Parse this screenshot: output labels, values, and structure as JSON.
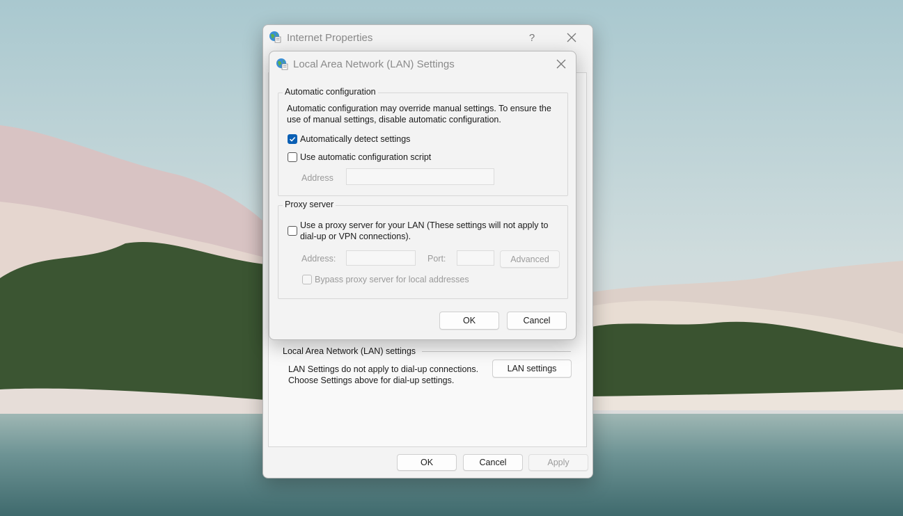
{
  "outer_window": {
    "title": "Internet Properties",
    "help_icon": "question-icon",
    "close_icon": "close-icon",
    "lan_section_label": "Local Area Network (LAN) settings",
    "lan_description": "LAN Settings do not apply to dial-up connections. Choose Settings above for dial-up settings.",
    "lan_settings_button": "LAN settings",
    "ok_label": "OK",
    "cancel_label": "Cancel",
    "apply_label": "Apply"
  },
  "dialog": {
    "title": "Local Area Network (LAN) Settings",
    "close_icon": "close-icon",
    "auto_config": {
      "label": "Automatic configuration",
      "description": "Automatic configuration may override manual settings.  To ensure the use of manual settings, disable automatic configuration.",
      "auto_detect_label": "Automatically detect settings",
      "auto_detect_checked": true,
      "script_label": "Use automatic configuration script",
      "script_checked": false,
      "address_label": "Address",
      "address_value": ""
    },
    "proxy": {
      "label": "Proxy server",
      "use_proxy_label": "Use a proxy server for your LAN (These settings will not apply to dial-up or VPN connections).",
      "use_proxy_checked": false,
      "address_label": "Address:",
      "address_value": "",
      "port_label": "Port:",
      "port_value": "",
      "advanced_label": "Advanced",
      "bypass_label": "Bypass proxy server for local addresses",
      "bypass_checked": false
    },
    "ok_label": "OK",
    "cancel_label": "Cancel"
  },
  "colors": {
    "accent": "#0a5fb4",
    "window_bg": "#f3f3f3"
  }
}
